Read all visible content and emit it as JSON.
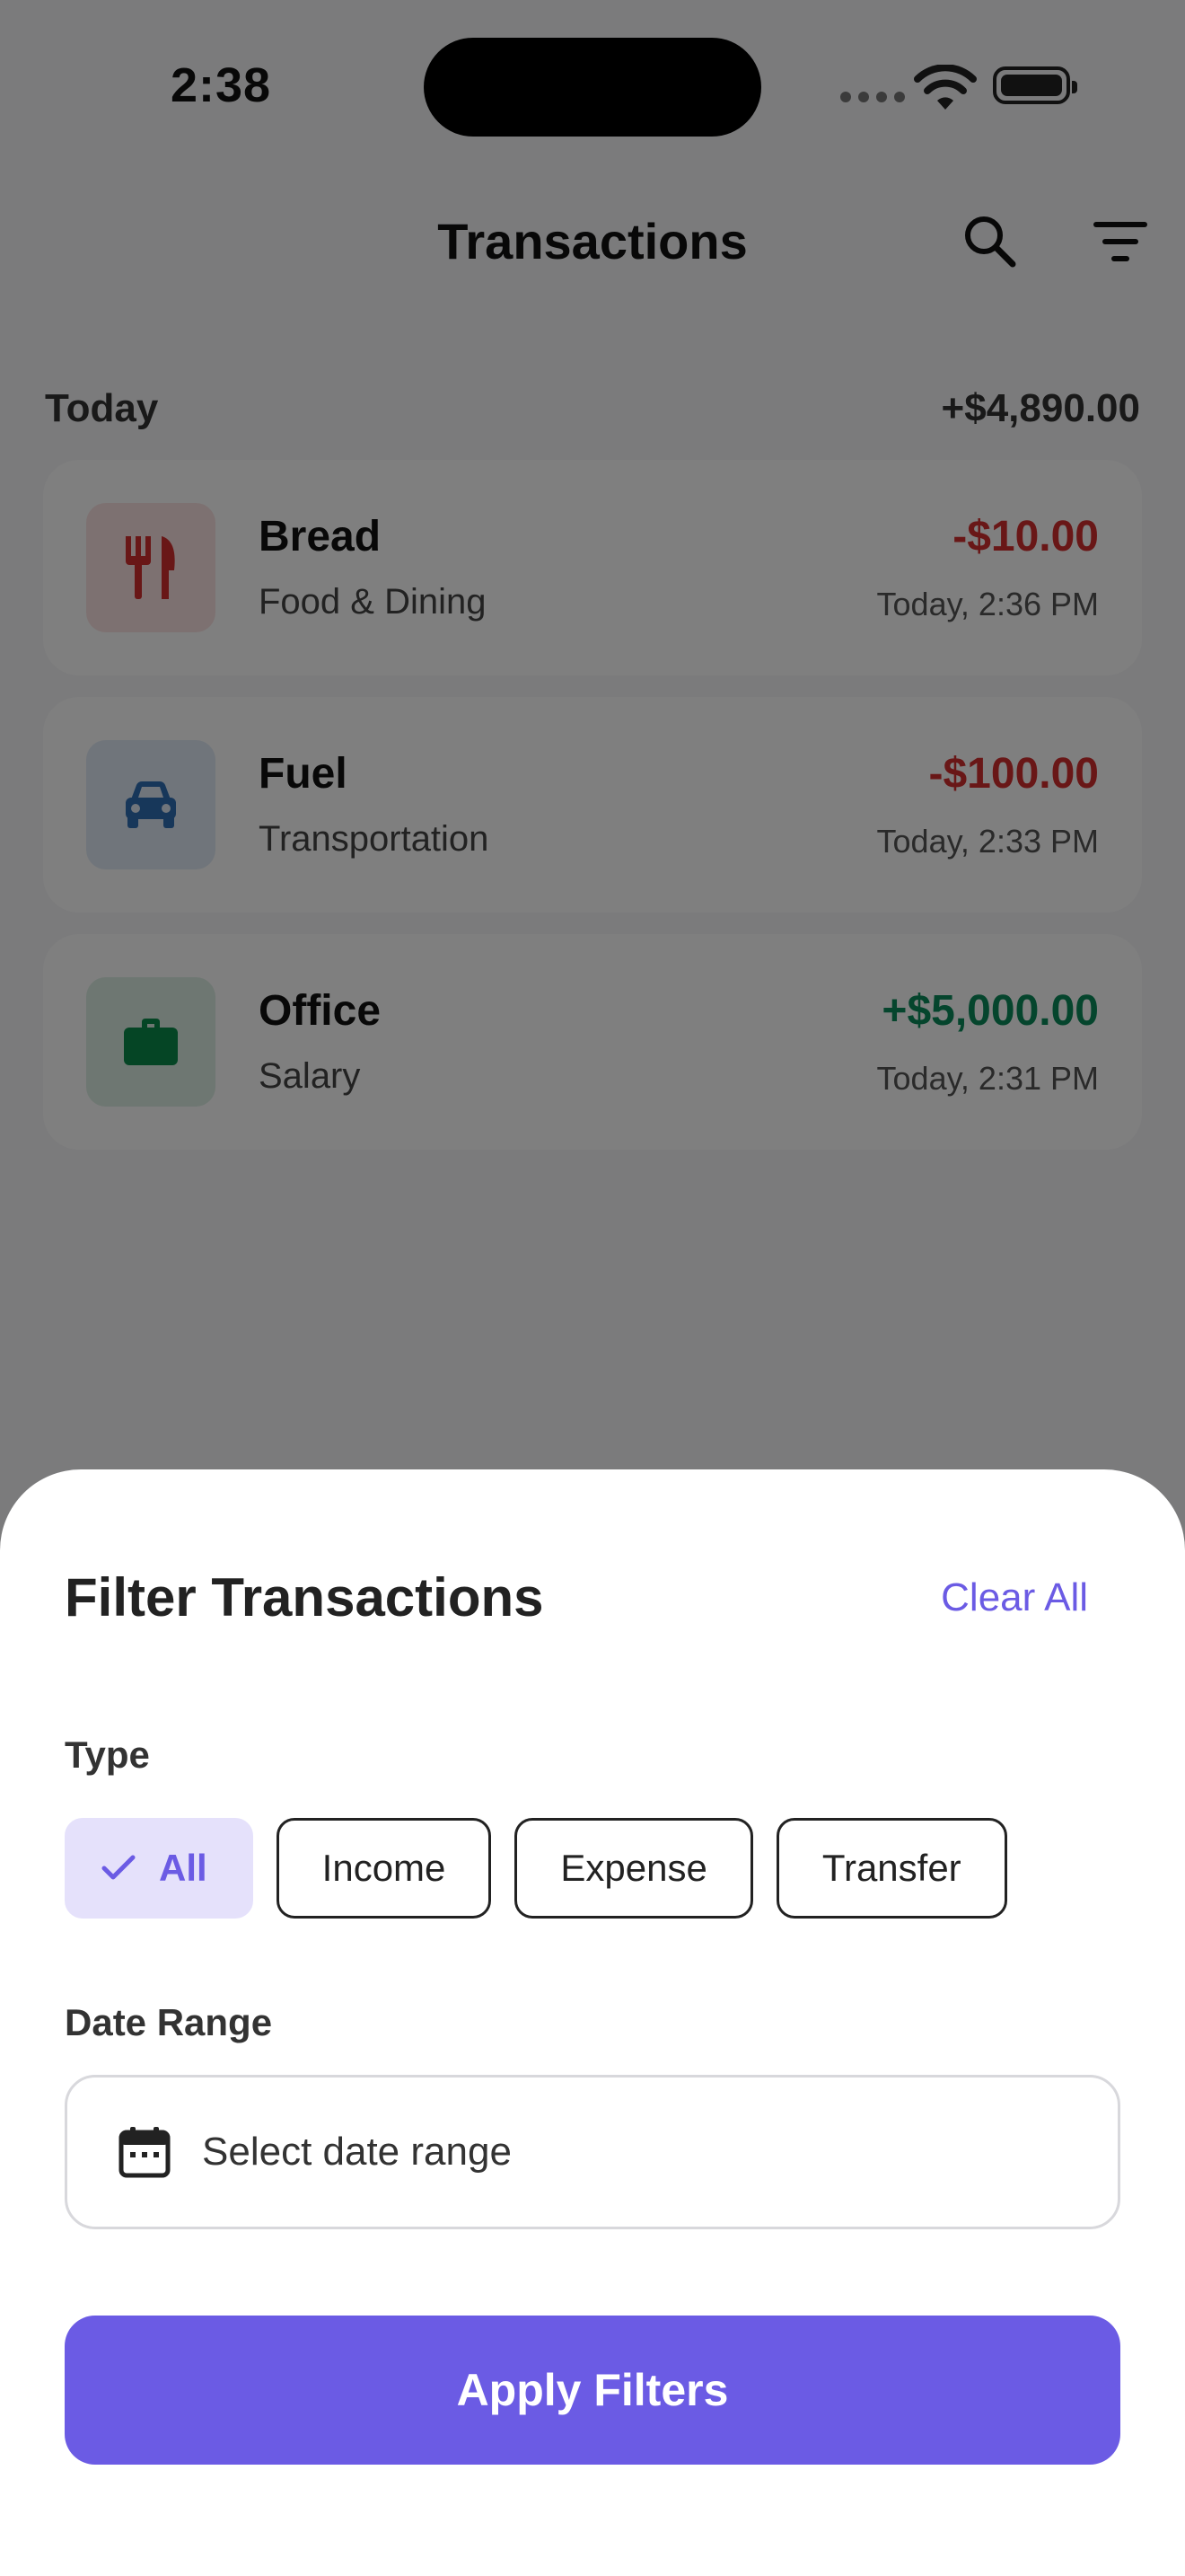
{
  "status_bar": {
    "time": "2:38"
  },
  "header": {
    "title": "Transactions"
  },
  "list": {
    "section_label": "Today",
    "section_total": "+$4,890.00",
    "transactions": [
      {
        "name": "Bread",
        "category": "Food & Dining",
        "amount": "-$10.00",
        "time": "Today, 2:36 PM",
        "icon": "utensils-icon",
        "type": "expense"
      },
      {
        "name": "Fuel",
        "category": "Transportation",
        "amount": "-$100.00",
        "time": "Today, 2:33 PM",
        "icon": "car-icon",
        "type": "expense"
      },
      {
        "name": "Office",
        "category": "Salary",
        "amount": "+$5,000.00",
        "time": "Today, 2:31 PM",
        "icon": "briefcase-icon",
        "type": "income"
      }
    ]
  },
  "filter_sheet": {
    "title": "Filter Transactions",
    "clear_label": "Clear All",
    "type_label": "Type",
    "type_options": [
      "All",
      "Income",
      "Expense",
      "Transfer"
    ],
    "selected_type": "All",
    "date_range_label": "Date Range",
    "date_placeholder": "Select date range",
    "apply_label": "Apply Filters"
  },
  "colors": {
    "accent": "#6b5be4",
    "accent_soft": "#e5e1fb",
    "expense": "#d32f2f",
    "income": "#0a8a5a"
  }
}
